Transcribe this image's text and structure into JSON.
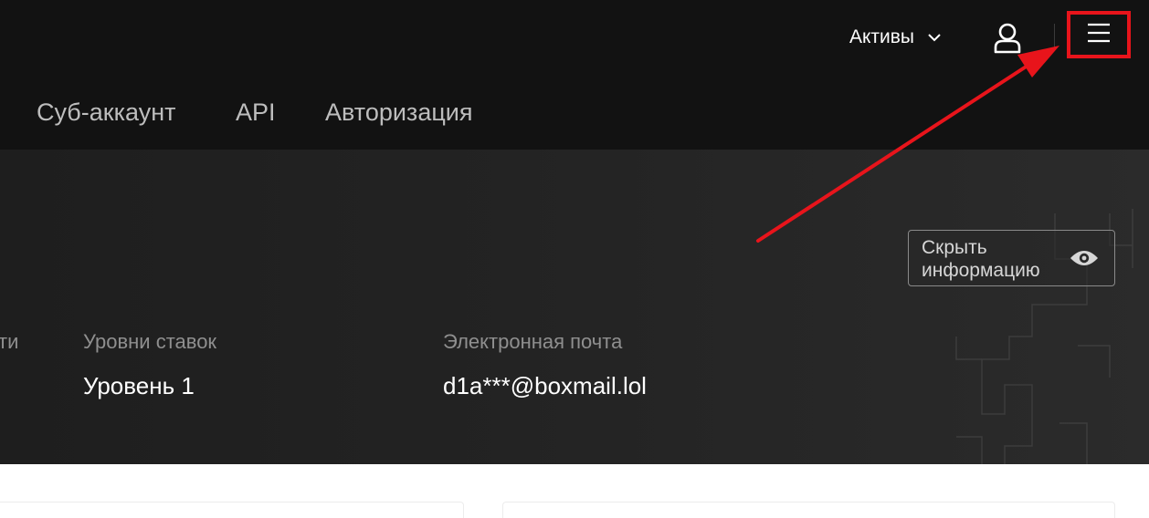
{
  "header": {
    "assets_label": "Активы"
  },
  "nav": {
    "items": [
      {
        "label": "Суб-аккаунт"
      },
      {
        "label": "API"
      },
      {
        "label": "Авторизация"
      }
    ]
  },
  "profile": {
    "hide_info_label": "Скрыть информацию",
    "partial_label": "ти",
    "fields": [
      {
        "label": "Уровни ставок",
        "value": "Уровень 1"
      },
      {
        "label": "Электронная почта",
        "value": "d1a***@boxmail.lol"
      }
    ]
  },
  "annotation": {
    "highlight_color": "#e8141b",
    "target": "menu-icon"
  },
  "icons": [
    "chevron-down-icon",
    "user-icon",
    "menu-icon",
    "eye-icon"
  ]
}
